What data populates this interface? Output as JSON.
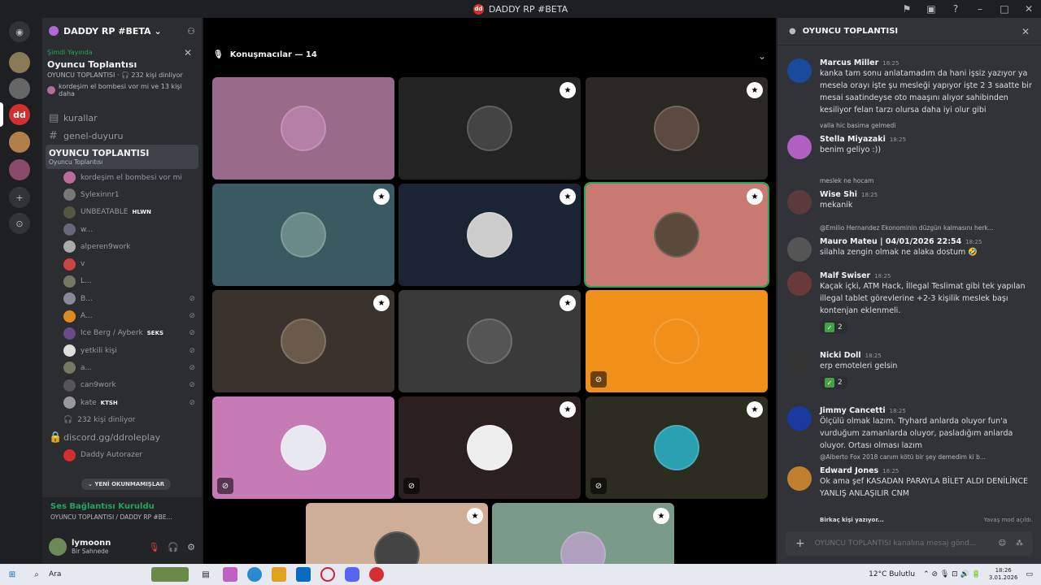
{
  "window": {
    "title": "DADDY RP #BETA"
  },
  "server": {
    "name": "DADDY RP #BETA"
  },
  "live": {
    "status": "Şimdi Yayında",
    "title": "Oyuncu Toplantısı",
    "channel_line": "OYUNCU TOPLANTISI · 🎧 232 kişi dinliyor",
    "listeners_line": "kordeşim el bombesi vor mi ve 13 kişi daha"
  },
  "channels": [
    {
      "name": "kurallar",
      "icon": "rules-icon"
    },
    {
      "name": "genel-duyuru",
      "icon": "hash-icon"
    }
  ],
  "active_channel": {
    "name": "OYUNCU TOPLANTISI",
    "subtitle": "Oyuncu Toplantısı"
  },
  "voice_users": [
    {
      "name": "kordeşim el bombesi vor mi",
      "color": "#b86c9a",
      "tag": ""
    },
    {
      "name": "Sylexinnr1",
      "color": "#777",
      "tag": ""
    },
    {
      "name": "UNBEATABLE",
      "color": "#554",
      "tag": "HLWN"
    },
    {
      "name": "w...",
      "color": "#667",
      "tag": ""
    },
    {
      "name": "alperen9work",
      "color": "#aaa",
      "tag": ""
    },
    {
      "name": "v",
      "color": "#c44",
      "tag": ""
    },
    {
      "name": "L...",
      "color": "#776",
      "tag": ""
    },
    {
      "name": "B...",
      "color": "#889",
      "tag": ""
    },
    {
      "name": "A...",
      "color": "#e08a1e",
      "tag": ""
    },
    {
      "name": "Ice Berg / Ayberk",
      "color": "#6a4a8a",
      "tag": "SEKS"
    },
    {
      "name": "yetkili kişi",
      "color": "#ddd",
      "tag": ""
    },
    {
      "name": "a...",
      "color": "#776",
      "tag": ""
    },
    {
      "name": "can9work",
      "color": "#555",
      "tag": ""
    },
    {
      "name": "kate",
      "color": "#999",
      "tag": "KTSH"
    }
  ],
  "listeners": "232 kişi dinliyor",
  "link_channel": "discord.gg/ddroleplay",
  "bots": [
    "Daddy Autorazer",
    "Daddy"
  ],
  "new_unread": "YENİ OKUNMAMIŞLAR",
  "voice_status": {
    "title": "Ses Bağlantısı Kuruldu",
    "sub": "OYUNCU TOPLANTISI / DADDY RP #BE..."
  },
  "user": {
    "name": "lymoonn",
    "status": "Bir Sahnede"
  },
  "stage": {
    "speakers": "Konuşmacılar — 14"
  },
  "tiles": [
    {
      "bg": "#9a6a8a",
      "pic": "#b57fa8",
      "badge": false,
      "mute": false
    },
    {
      "bg": "#232323",
      "pic": "#444",
      "badge": true,
      "mute": false
    },
    {
      "bg": "#2b2725",
      "pic": "#5a4a42",
      "badge": true,
      "mute": false
    },
    {
      "bg": "#3a5a62",
      "pic": "#6a8a88",
      "badge": true,
      "mute": false
    },
    {
      "bg": "#1b2433",
      "pic": "#ccc",
      "badge": true,
      "mute": false
    },
    {
      "bg": "#c87a72",
      "pic": "#5a4a3a",
      "badge": true,
      "mute": false
    },
    {
      "bg": "#3a322c",
      "pic": "#6a5a4a",
      "badge": true,
      "mute": false
    },
    {
      "bg": "#3a3a3a",
      "pic": "#555",
      "badge": true,
      "mute": false
    },
    {
      "bg": "#f0901a",
      "pic": "#f0901a",
      "badge": false,
      "mute": true
    },
    {
      "bg": "#c67ab6",
      "pic": "#e8e8f0",
      "badge": false,
      "mute": true
    },
    {
      "bg": "#2a2020",
      "pic": "#eee",
      "badge": true,
      "mute": true
    },
    {
      "bg": "#2c2c20",
      "pic": "#2aa0b0",
      "badge": true,
      "mute": true
    },
    {
      "bg": "#cfae98",
      "pic": "#444",
      "badge": true,
      "mute": false
    },
    {
      "bg": "#7a9a8a",
      "pic": "#b0a0c0",
      "badge": true,
      "mute": false
    }
  ],
  "chat": {
    "title": "OYUNCU TOPLANTISI",
    "messages": [
      {
        "name": "Marcus Miller",
        "time": "18:25",
        "text": "kanka tam sonu anlatamadım da hani işsiz yazıyor ya mesela orayı işte şu mesleği yapıyor işte 2 3 saatte bir mesai saatindeyse oto maaşını alıyor sahibinden kesiliyor felan tarzı olursa daha iyi olur gibi",
        "color": "#1a4a9a",
        "reply": ""
      },
      {
        "name": "Stella Miyazaki",
        "time": "18:25",
        "text": "benim geliyo :))",
        "color": "#b060c0",
        "reply": "valla hic basima gelmedi"
      },
      {
        "name": "Wise Shi",
        "time": "18:25",
        "text": "mekanik",
        "color": "#5a3a3a",
        "reply": "meslek ne hocam"
      },
      {
        "name": "Mauro Mateu | 04/01/2026 22:54",
        "time": "18:25",
        "text": "silahla zengin olmak ne alaka dostum 🤣",
        "color": "#555",
        "reply": "@Emilio Hernandez Ekonominin düzgün kalmasını herk..."
      },
      {
        "name": "Malf Swiser",
        "time": "18:25",
        "text": "Kaçak içki, ATM Hack, İllegal Teslimat gibi tek yapılan illegal tablet görevlerine +2-3 kişilik meslek başı kontenjan eklenmeli.",
        "color": "#6a3a3a",
        "reply": ""
      },
      {
        "name": "Nicki Doll",
        "time": "18:25",
        "text": "erp emoteleri gelsin",
        "color": "#333",
        "reply": ""
      },
      {
        "name": "Jimmy Cancetti",
        "time": "18:25",
        "text": "Ölçülü olmak lazım. Tryhard anlarda oluyor fun'a vurduğum zamanlarda oluyor, pasladığım anlarda oluyor. Ortası olması lazım",
        "color": "#1a3aa0",
        "reply": ""
      },
      {
        "name": "Edward Jones",
        "time": "18:25",
        "text": "Ok ama şef KASADAN PARAYLA BİLET ALDI DENİLİNCE YANLIŞ ANLAŞILIR CNM",
        "color": "#c08030",
        "reply": "@Alberto Fox 2018 canım kötü bir şey demedim ki b..."
      }
    ],
    "reaction_count": "2",
    "typing": "Birkaç kişi yazıyor...",
    "slowmode": "Yavaş mod açıldı.",
    "placeholder": "OYUNCU TOPLANTISI kanalına mesaj gönd..."
  },
  "taskbar": {
    "search": "Ara",
    "weather": "12°C Bulutlu",
    "time": "18:26",
    "date": "3.01.2026"
  }
}
